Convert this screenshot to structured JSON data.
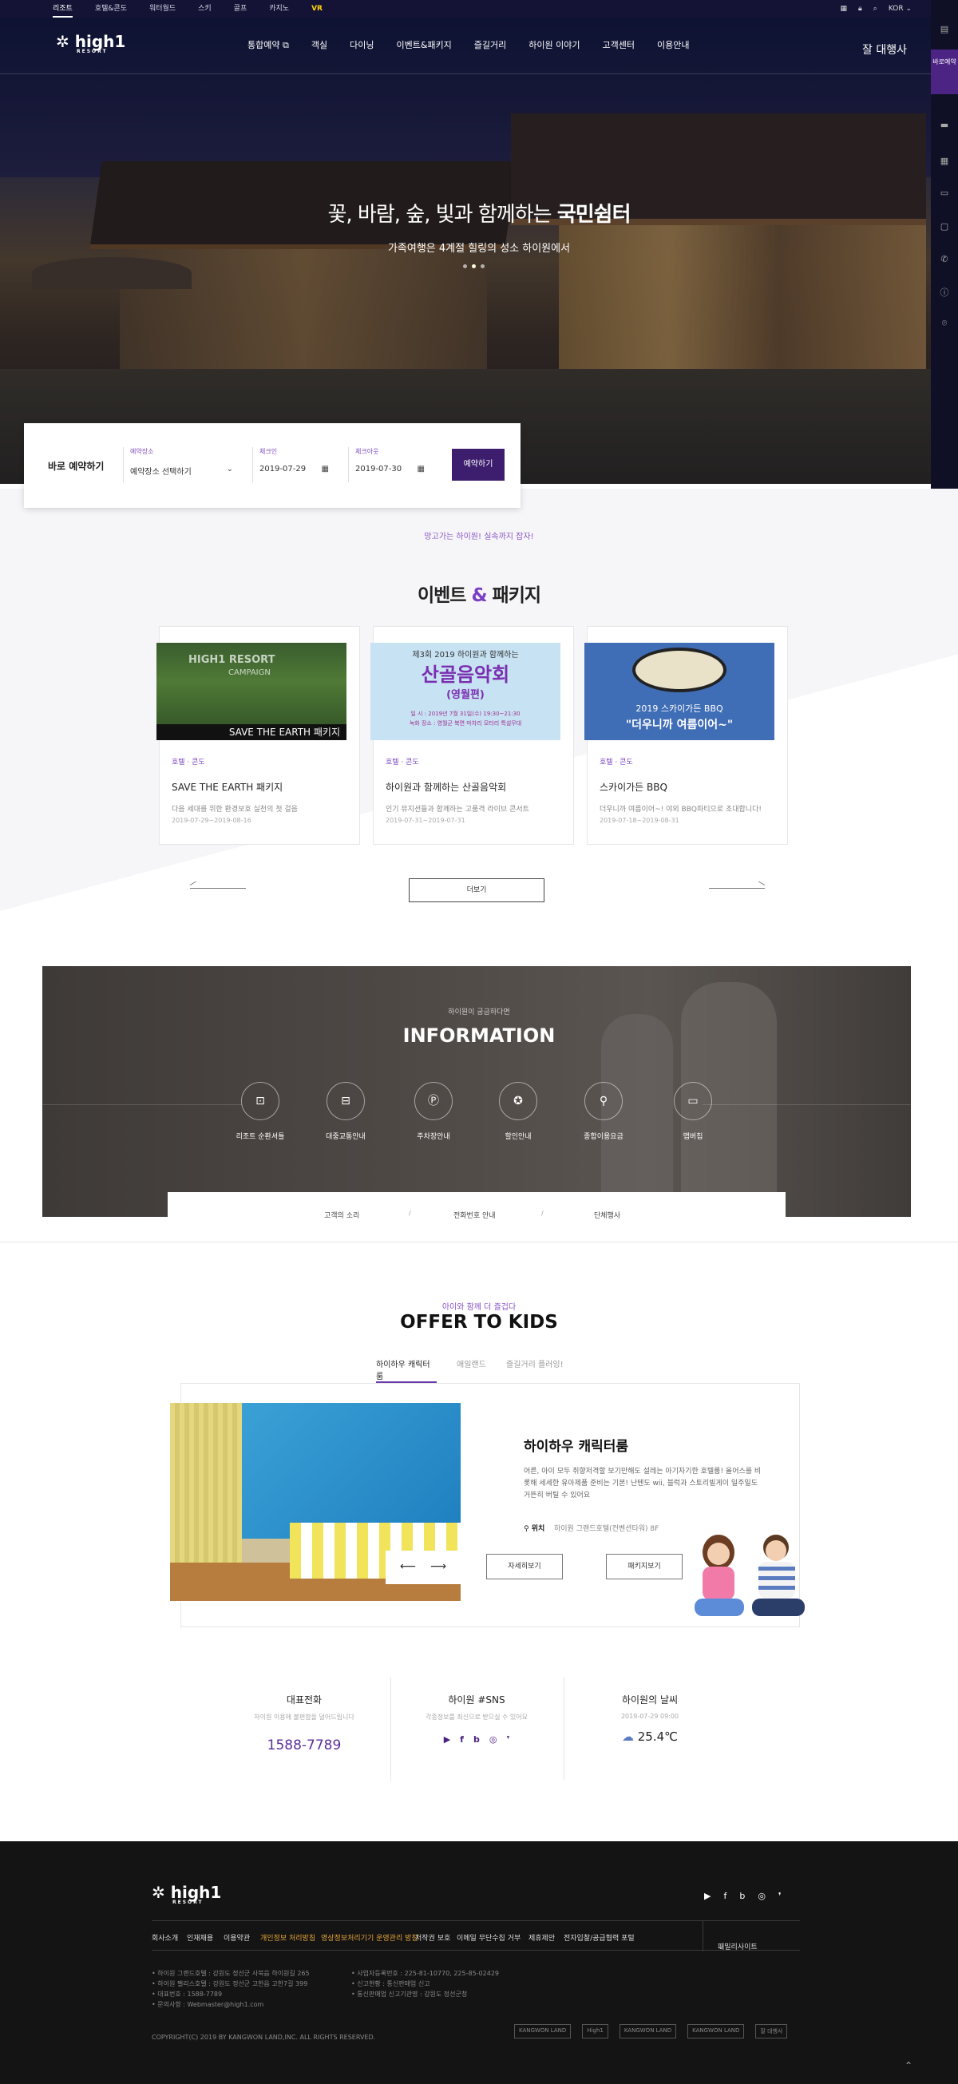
{
  "topbar": {
    "links": [
      "리조트",
      "호텔&콘도",
      "워터월드",
      "스키",
      "골프",
      "카지노",
      "VR"
    ],
    "lang": "KOR"
  },
  "header": {
    "logo": "high1",
    "logo_sub": "RESORT",
    "nav": [
      "통합예약 ⧉",
      "객실",
      "다이닝",
      "이벤트&패키지",
      "즐길거리",
      "하이원 이야기",
      "고객센터",
      "이용안내"
    ],
    "brand": "잘 대행사"
  },
  "quick": {
    "book": "BOOK",
    "book_label": "바로예약"
  },
  "hero": {
    "title_pre": "꽃, 바람, 숲, 빛과 함께하는 ",
    "title_bold": "국민쉼터",
    "subtitle": "가족여행은 4계절 힐링의 성소 하이원에서"
  },
  "reservation": {
    "title": "바로 예약하기",
    "place_label": "예약장소",
    "place_value": "예약장소 선택하기",
    "checkin_label": "체크인",
    "checkin_value": "2019-07-29",
    "checkout_label": "체크아웃",
    "checkout_value": "2019-07-30",
    "button": "예약하기"
  },
  "events": {
    "subtitle": "망고가는 하이원! 실속까지 잡자!",
    "title_a": "이벤트 ",
    "title_amp": "&",
    "title_b": " 패키지",
    "more": "더보기",
    "cards": [
      {
        "category": "호텔 · 콘도",
        "name": "SAVE THE EARTH 패키지",
        "desc": "다음 세대를 위한 환경보호 실천의 첫 걸음",
        "date": "2019-07-29~2019-08-16",
        "banner": "SAVE THE EARTH 패키지",
        "banner_top": "HIGH1 RESORT",
        "banner_mid": "CAMPAIGN"
      },
      {
        "category": "호텔 · 콘도",
        "name": "하이원과 함께하는 산골음악회",
        "desc": "인기 뮤지션들과 함께하는 고품격 라이브 콘서트",
        "date": "2019-07-31~2019-07-31",
        "banner_top": "제3회 2019 하이원과 함께하는",
        "banner_main": "산골음악회",
        "banner_sub": "(영월편)",
        "banner_info1": "일    시 : 2019년 7월 31일(수) 19:30~21:30",
        "banner_info2": "녹화 장소 : 영월군 북면 마차리 모터리 특설무대"
      },
      {
        "category": "호텔 · 콘도",
        "name": "스카이가든 BBQ",
        "desc": "더우니까 여름이어~! 야외 BBQ파티으로 초대합니다!",
        "date": "2019-07-18~2019-08-31",
        "banner_top": "2019 스카이가든 BBQ",
        "banner_main": "\"더우니까 여름이어~\""
      }
    ]
  },
  "information": {
    "subtitle": "하이원이 궁금하다면",
    "title": "INFORMATION",
    "items": [
      {
        "label": "리조트 순환셔틀",
        "icon": "bus-icon",
        "glyph": "🚌"
      },
      {
        "label": "대중교통안내",
        "icon": "train-icon",
        "glyph": "🚆"
      },
      {
        "label": "주차장안내",
        "icon": "parking-icon",
        "glyph": "P"
      },
      {
        "label": "할인안내",
        "icon": "discount-icon",
        "glyph": "✪"
      },
      {
        "label": "종합이용요금",
        "icon": "price-tag-icon",
        "glyph": "₩"
      },
      {
        "label": "맵버칩",
        "icon": "ticket-icon",
        "glyph": "▭"
      }
    ],
    "bar": [
      "고객의 소리",
      "전화번호 안내",
      "단체행사"
    ]
  },
  "kids": {
    "subtitle": "아이와 함께 더 즐겁다",
    "title": "OFFER TO KIDS",
    "tabs": [
      "하이하우 캐릭터룸",
      "애일랜드",
      "즐길거리 플러잉!"
    ],
    "room_name": "하이하우 캐릭터룸",
    "room_desc": "어른, 아이 모두 취향저격할 보기만해도 설레는 아기자기한 호텔룸! 올어스를 비롯해 세세한 유아제품 준비는 기본! 난텐도 wii, 블럭과 스토리빌게이 일주일도 거뜬히 버틸 수 있어요",
    "loc_label": "위치",
    "loc_value": "하이원 그랜드호텔(컨벤션타워) 8F",
    "btn_detail": "자세히보기",
    "btn_package": "패키지보기"
  },
  "contact": {
    "phone_title": "대표전화",
    "phone_sub": "하이원 이용에 불편함을 덜어드립니다",
    "phone": "1588-7789",
    "sns_title": "하이원 #SNS",
    "sns_sub": "각종정보를 최신으로 받으실 수 있어요",
    "weather_title": "하이원의 날씨",
    "weather_sub": "2019-07-29 09:00",
    "weather_temp": "25.4℃"
  },
  "footer": {
    "logo": "high1",
    "logo_sub": "RESORT",
    "nav": [
      {
        "label": "회사소개",
        "hl": false
      },
      {
        "label": "인재채용",
        "hl": false
      },
      {
        "label": "이용약관",
        "hl": false
      },
      {
        "label": "개인정보 처리방침",
        "hl": true
      },
      {
        "label": "영상정보처리기기 운영관리 방침",
        "hl": true
      },
      {
        "label": "저작권 보호",
        "hl": false
      },
      {
        "label": "이메일 무단수집 거부",
        "hl": false
      },
      {
        "label": "제휴제안",
        "hl": false
      },
      {
        "label": "전자입찰/공급협력 포털",
        "hl": false
      }
    ],
    "family_site": "패밀리사이트",
    "addr_left": [
      "하이원 그랜드호텔 : 강원도 정선군 사북읍 하이원길 265",
      "하이원 팰리스호텔 : 강원도 정선군 고한읍 고한7길 399",
      "대표번호 : 1588-7789",
      "문의사항 : Webmaster@high1.com"
    ],
    "addr_right": [
      "사업자등록번호 : 225-81-10770, 225-85-02429",
      "신고현황 : 통신판매업 신고",
      "통신판매업 신고기관명 : 강원도 정선군청"
    ],
    "copyright": "COPYRIGHT(C) 2019 BY KANGWON LAND,INC. ALL RIGHTS RESERVED.",
    "partners": [
      "KANGWON LAND",
      "High1",
      "KANGWON LAND",
      "KANGWON LAND",
      "잘 대행사"
    ],
    "top": "⌃"
  }
}
